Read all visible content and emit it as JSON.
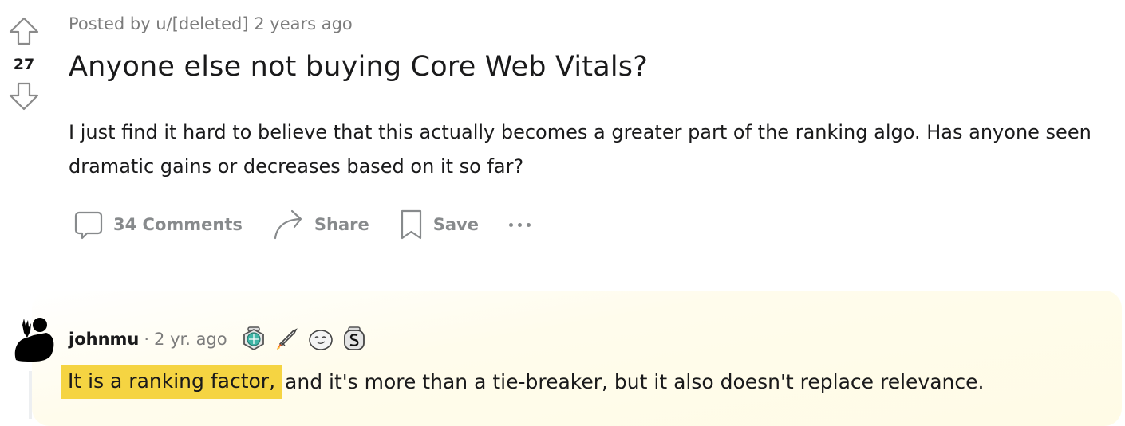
{
  "post": {
    "score": "27",
    "meta": "Posted by u/[deleted] 2 years ago",
    "title": "Anyone else not buying Core Web Vitals?",
    "body": "I just find it hard to believe that this actually becomes a greater part of the ranking algo. Has anyone seen dramatic gains or decreases based on it so far?",
    "actions": {
      "comments": "34 Comments",
      "share": "Share",
      "save": "Save"
    }
  },
  "comment": {
    "username": "johnmu",
    "separator": "·",
    "time": "2 yr. ago",
    "awards": [
      "helpful-award-icon",
      "rocket-award-icon",
      "seal-award-icon",
      "silver-award-icon"
    ],
    "highlighted_text": "It is a ranking factor,",
    "rest_text": "and it's more than a tie-breaker, but it also doesn't replace relevance."
  },
  "colors": {
    "highlight": "#f5d442",
    "muted": "#878a8c",
    "text": "#1a1a1b"
  }
}
